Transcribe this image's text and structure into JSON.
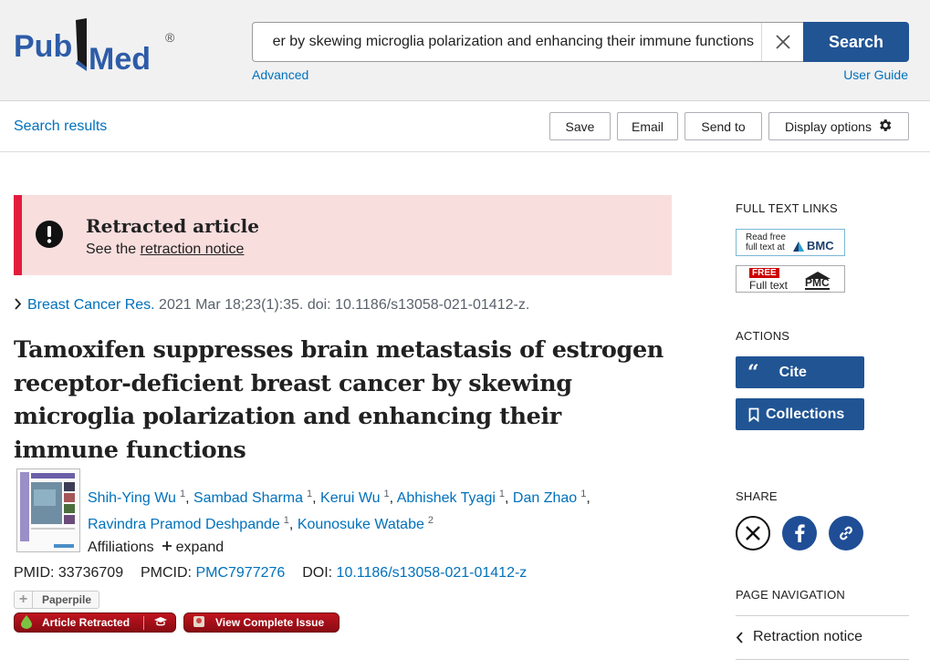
{
  "header": {
    "logo_text": "PubMed",
    "search_query": "er by skewing microglia polarization and enhancing their immune functions",
    "search_button": "Search",
    "advanced_link": "Advanced",
    "user_guide_link": "User Guide"
  },
  "toolbar": {
    "search_results_link": "Search results",
    "save_button": "Save",
    "email_button": "Email",
    "send_to_button": "Send to",
    "display_options_button": "Display options"
  },
  "retraction": {
    "title": "Retracted article",
    "see_the": "See the ",
    "notice_link": "retraction notice"
  },
  "citation": {
    "journal": "Breast Cancer Res.",
    "details": " 2021 Mar 18;23(1):35. doi: 10.1186/s13058-021-01412-z."
  },
  "article": {
    "title": "Tamoxifen suppresses brain metastasis of estrogen receptor-deficient breast cancer by skewing microglia polarization and enhancing their immune functions",
    "authors": [
      {
        "name": "Shih-Ying Wu",
        "aff": "1"
      },
      {
        "name": "Sambad Sharma",
        "aff": "1"
      },
      {
        "name": "Kerui Wu",
        "aff": "1"
      },
      {
        "name": "Abhishek Tyagi",
        "aff": "1"
      },
      {
        "name": "Dan Zhao",
        "aff": "1"
      },
      {
        "name": "Ravindra Pramod Deshpande",
        "aff": "1"
      },
      {
        "name": "Kounosuke Watabe",
        "aff": "2"
      }
    ],
    "affiliations_label": "Affiliations",
    "expand_label": "expand",
    "pmid_label": "PMID:",
    "pmid": "33736709",
    "pmcid_label": "PMCID:",
    "pmcid": "PMC7977276",
    "doi_label": "DOI:",
    "doi": "10.1186/s13058-021-01412-z"
  },
  "extensions": {
    "paperpile": "Paperpile",
    "article_retracted": "Article Retracted",
    "view_complete_issue": "View Complete Issue"
  },
  "sidebar": {
    "full_text_links_heading": "FULL TEXT LINKS",
    "bmc_line1": "Read free",
    "bmc_line2": "full text at",
    "bmc_brand": "BMC",
    "pmc_free": "FREE",
    "pmc_full_text": "Full text",
    "pmc_brand": "PMC",
    "actions_heading": "ACTIONS",
    "cite_button": "Cite",
    "collections_button": "Collections",
    "share_heading": "SHARE",
    "page_navigation_heading": "PAGE NAVIGATION",
    "retraction_notice_link": "Retraction notice"
  },
  "colors": {
    "primary_blue": "#205493",
    "link_blue": "#0071bc",
    "retraction_bg": "#f9dede",
    "retraction_border": "#e31c3d",
    "facebook_blue": "#1f4e96"
  }
}
